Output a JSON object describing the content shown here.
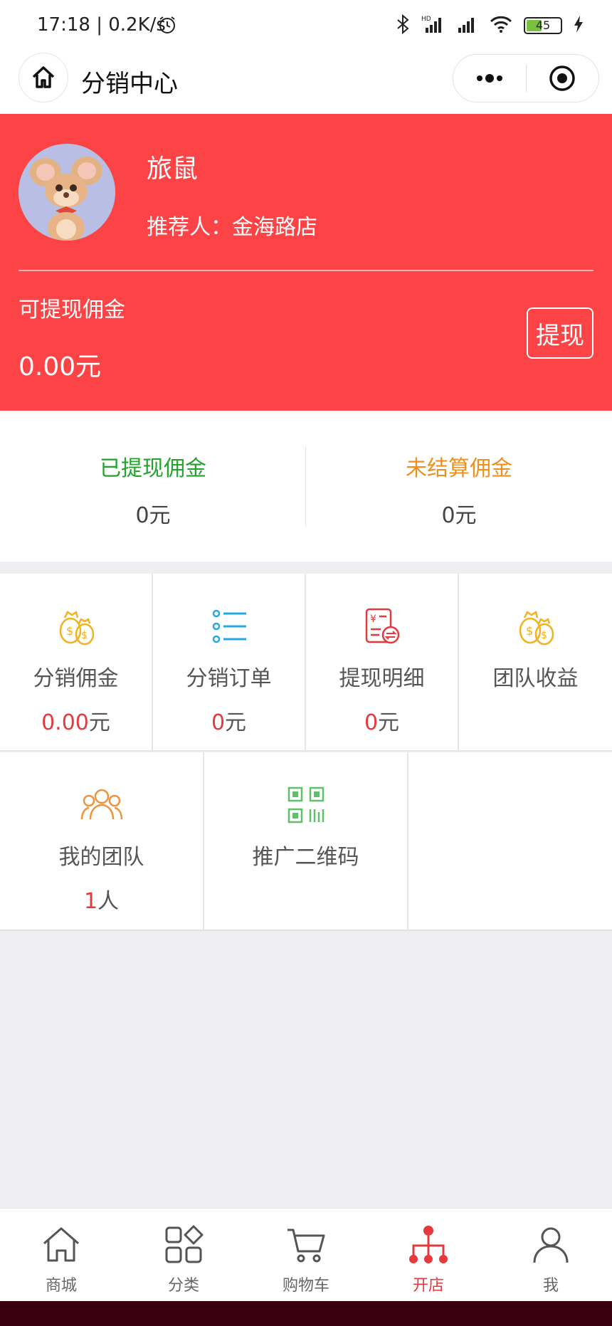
{
  "status": {
    "time_speed": "17:18 | 0.2K/s",
    "battery_level": 45,
    "battery_text": "45",
    "battery_color": "#7ac143"
  },
  "header": {
    "title": "分销中心"
  },
  "profile": {
    "name": "旅鼠",
    "recommender": "推荐人：金海路店",
    "withdrawable_label": "可提现佣金",
    "withdrawable_amount": "0.00元",
    "withdraw_button": "提现",
    "card_color": "#fc4447"
  },
  "summary": {
    "withdrawn": {
      "label": "已提现佣金",
      "value": "0元",
      "color": "#22a32d"
    },
    "unsettled": {
      "label": "未结算佣金",
      "value": "0元",
      "color": "#f0901c"
    }
  },
  "grid": [
    {
      "label": "分销佣金",
      "num": "0.00",
      "unit": "元",
      "icon": "money-bags-icon"
    },
    {
      "label": "分销订单",
      "num": "0",
      "unit": "元",
      "icon": "list-icon"
    },
    {
      "label": "提现明细",
      "num": "0",
      "unit": "元",
      "icon": "withdraw-detail-icon"
    },
    {
      "label": "团队收益",
      "num": "",
      "unit": "",
      "icon": "money-bags-icon"
    },
    {
      "label": "我的团队",
      "num": "1",
      "unit": "人",
      "icon": "team-icon"
    },
    {
      "label": "推广二维码",
      "num": "",
      "unit": "",
      "icon": "qr-code-icon"
    }
  ],
  "tabs": [
    {
      "label": "商城",
      "icon": "home-icon"
    },
    {
      "label": "分类",
      "icon": "category-icon"
    },
    {
      "label": "购物车",
      "icon": "cart-icon"
    },
    {
      "label": "开店",
      "icon": "shop-network-icon",
      "active": true
    },
    {
      "label": "我",
      "icon": "user-icon"
    }
  ],
  "accent_color": "#e5393e"
}
